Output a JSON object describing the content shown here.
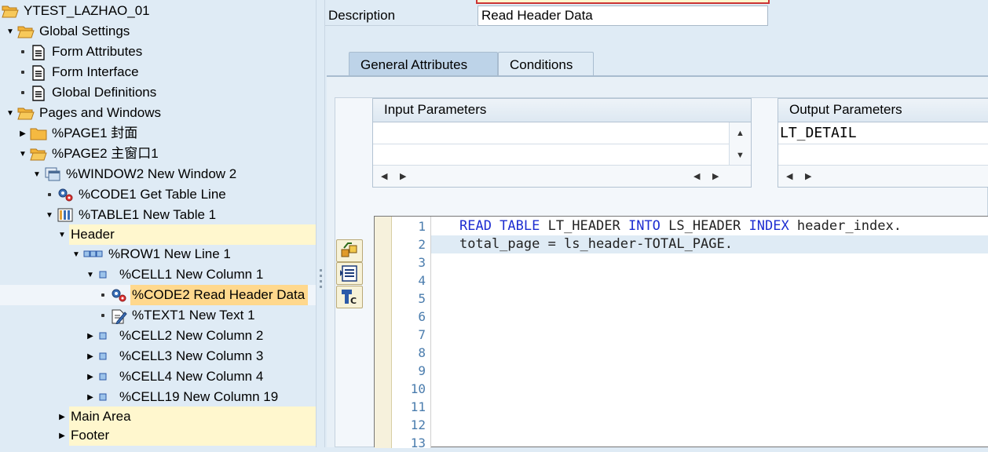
{
  "tree": {
    "nodes": [
      {
        "label": "YTEST_LAZHAO_01",
        "icon": "open-folder-icon",
        "toggle": "none"
      },
      {
        "label": "Global Settings",
        "icon": "open-folder-icon",
        "toggle": "expanded"
      },
      {
        "label": "Form Attributes",
        "icon": "document-icon",
        "toggle": "leaf"
      },
      {
        "label": "Form Interface",
        "icon": "document-icon",
        "toggle": "leaf"
      },
      {
        "label": "Global Definitions",
        "icon": "document-icon",
        "toggle": "leaf"
      },
      {
        "label": "Pages and Windows",
        "icon": "open-folder-icon",
        "toggle": "expanded"
      },
      {
        "label": "%PAGE1 封面",
        "icon": "closed-folder-icon",
        "toggle": "collapsed"
      },
      {
        "label": "%PAGE2 主窗口1",
        "icon": "open-folder-icon",
        "toggle": "expanded"
      },
      {
        "label": "%WINDOW2 New Window 2",
        "icon": "window-icon",
        "toggle": "expanded"
      },
      {
        "label": "%CODE1 Get Table Line",
        "icon": "program-lines-icon",
        "toggle": "leaf"
      },
      {
        "label": "%TABLE1 New Table 1",
        "icon": "table-icon",
        "toggle": "expanded"
      },
      {
        "label": "Header",
        "icon": "",
        "toggle": "expanded"
      },
      {
        "label": "%ROW1 New Line 1",
        "icon": "row-icon",
        "toggle": "expanded"
      },
      {
        "label": "%CELL1 New Column 1",
        "icon": "cell-icon",
        "toggle": "expanded"
      },
      {
        "label": "%CODE2 Read Header Data",
        "icon": "program-lines-icon",
        "toggle": "leaf"
      },
      {
        "label": "%TEXT1 New Text 1",
        "icon": "text-edit-icon",
        "toggle": "leaf"
      },
      {
        "label": "%CELL2 New Column 2",
        "icon": "cell-icon",
        "toggle": "collapsed"
      },
      {
        "label": "%CELL3 New Column 3",
        "icon": "cell-icon",
        "toggle": "collapsed"
      },
      {
        "label": "%CELL4 New Column 4",
        "icon": "cell-icon",
        "toggle": "collapsed"
      },
      {
        "label": "%CELL19 New Column 19",
        "icon": "cell-icon",
        "toggle": "collapsed"
      },
      {
        "label": "Main Area",
        "icon": "",
        "toggle": "collapsed"
      },
      {
        "label": "Footer",
        "icon": "",
        "toggle": "collapsed"
      }
    ],
    "selected": "%CODE2 Read Header Data"
  },
  "description": {
    "label": "Description",
    "value": "Read Header Data"
  },
  "tabs": [
    {
      "label": "General Attributes",
      "active": true
    },
    {
      "label": "Conditions",
      "active": false
    }
  ],
  "input_parameters": {
    "title": "Input Parameters",
    "rows": [
      "",
      ""
    ]
  },
  "output_parameters": {
    "title": "Output Parameters",
    "rows": [
      "LT_DETAIL",
      ""
    ]
  },
  "toolbar": [
    {
      "icon": "insert-statement-icon"
    },
    {
      "icon": "pattern-icon"
    },
    {
      "icon": "check-program-icon"
    }
  ],
  "editor": {
    "line_numbers": [
      "1",
      "2",
      "3",
      "4",
      "5",
      "6",
      "7",
      "8",
      "9",
      "10",
      "11",
      "12",
      "13"
    ],
    "lines": [
      [
        {
          "t": "READ TABLE",
          "k": true
        },
        {
          "t": " LT_HEADER ",
          "k": false
        },
        {
          "t": "INTO",
          "k": true
        },
        {
          "t": " LS_HEADER ",
          "k": false
        },
        {
          "t": "INDEX",
          "k": true
        },
        {
          "t": " header_index.",
          "k": false
        }
      ],
      [
        {
          "t": "total_page = ls_header-TOTAL_PAGE.",
          "k": false
        }
      ]
    ]
  },
  "colors": {
    "keyword": "#1d2dd1",
    "line_number": "#4a7cad",
    "selection": "#ffd88d",
    "header_band": "#fff7ce"
  }
}
